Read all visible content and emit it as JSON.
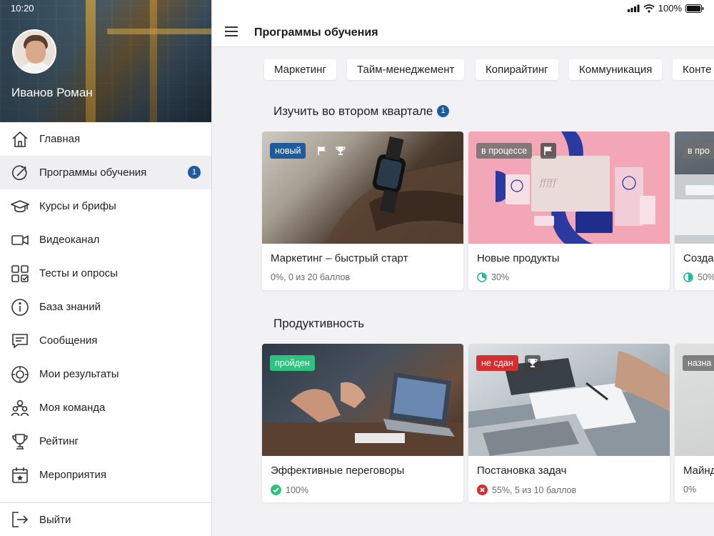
{
  "status": {
    "time": "10:20",
    "battery": "100%"
  },
  "user": {
    "name": "Иванов Роман"
  },
  "sidebar": {
    "items": [
      {
        "label": "Главная",
        "icon": "home-icon"
      },
      {
        "label": "Программы обучения",
        "icon": "programs-icon",
        "badge": "1",
        "active": true
      },
      {
        "label": "Курсы и брифы",
        "icon": "graduation-cap-icon"
      },
      {
        "label": "Видеоканал",
        "icon": "video-camera-icon"
      },
      {
        "label": "Тесты и опросы",
        "icon": "tests-icon"
      },
      {
        "label": "База знаний",
        "icon": "info-icon"
      },
      {
        "label": "Сообщения",
        "icon": "message-icon"
      },
      {
        "label": "Мои результаты",
        "icon": "results-icon"
      },
      {
        "label": "Моя команда",
        "icon": "team-icon"
      },
      {
        "label": "Рейтинг",
        "icon": "trophy-icon"
      },
      {
        "label": "Мероприятия",
        "icon": "calendar-star-icon"
      }
    ],
    "logout": "Выйти"
  },
  "header": {
    "title": "Программы обучения"
  },
  "chips": [
    "Маркетинг",
    "Тайм-менеджемент",
    "Копирайтинг",
    "Коммуникация",
    "Конте"
  ],
  "sections": [
    {
      "title": "Изучить во втором квартале",
      "badge": "1",
      "cards": [
        {
          "title": "Маркетинг – быстрый старт",
          "tag": "новый",
          "meta": "0%, 0 из 20 баллов"
        },
        {
          "title": "Новые продукты",
          "tag": "в процессе",
          "meta": "30%"
        },
        {
          "title": "Созда",
          "tag": "в про",
          "meta": "50%"
        }
      ]
    },
    {
      "title": "Продуктивность",
      "cards": [
        {
          "title": "Эффективные переговоры",
          "tag": "пройден",
          "meta": "100%"
        },
        {
          "title": "Постановка задач",
          "tag": "не сдан",
          "meta": "55%, 5 из 10 баллов"
        },
        {
          "title": "Майнд",
          "tag": "назна",
          "meta": "0%"
        }
      ]
    }
  ],
  "colors": {
    "accent": "#1f5c9e",
    "tag_new": "#1f5c9e",
    "tag_progress": "#7a7a7a",
    "tag_passed": "#2ec27e",
    "tag_failed": "#d32f2f",
    "progress_teal": "#19b39a"
  }
}
